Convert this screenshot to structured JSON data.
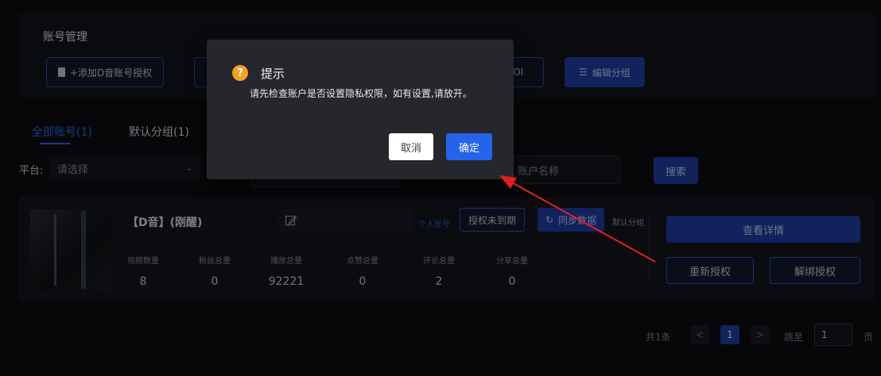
{
  "panel": {
    "title": "账号管理",
    "add_button": "+添加D音账号授权",
    "poi_button": "POI",
    "edit_group_button": "编辑分组"
  },
  "tabs": [
    {
      "label": "全部账号(1)",
      "active": true
    },
    {
      "label": "默认分组(1)",
      "active": false
    }
  ],
  "filter": {
    "platform_label": "平台:",
    "platform_placeholder": "请选择",
    "account_name_placeholder": "账户名称",
    "search_button": "搜索"
  },
  "account": {
    "name": "【D音】(刚醒)",
    "personal_link": "个人账号",
    "auth_status": "授权未到期",
    "sync_button": "同步数据",
    "group": "默认分组",
    "stats": [
      {
        "label": "视频数量",
        "value": "8"
      },
      {
        "label": "粉丝总量",
        "value": "0"
      },
      {
        "label": "播放总量",
        "value": "92221"
      },
      {
        "label": "点赞总量",
        "value": "0"
      },
      {
        "label": "评论总量",
        "value": "2"
      },
      {
        "label": "分享总量",
        "value": "0"
      }
    ],
    "detail_button": "查看详情",
    "reauth_button": "重新授权",
    "unbind_button": "解绑授权"
  },
  "pagination": {
    "total": "共1条",
    "prev": "<",
    "current_page": "1",
    "next": ">",
    "goto_label": "跳至",
    "goto_value": "1",
    "unit": "页"
  },
  "modal": {
    "icon": "question-icon",
    "title": "提示",
    "message": "请先检查账户是否设置隐私权限，如有设置,请放开。",
    "cancel_button": "取消",
    "confirm_button": "确定"
  },
  "colors": {
    "accent": "#2563eb",
    "warning": "#f2a21b",
    "annotation": "#e02020"
  }
}
